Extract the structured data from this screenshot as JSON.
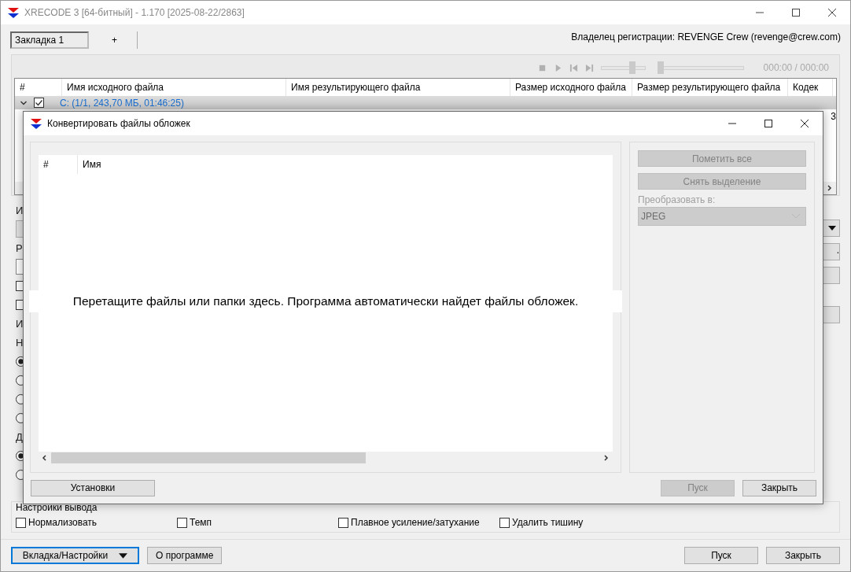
{
  "window": {
    "title": "XRECODE 3 [64-битный] - 1.170 [2025-08-22/2863]"
  },
  "tabs": [
    {
      "label": "Закладка 1",
      "selected": true
    },
    {
      "label": "+",
      "selected": false
    }
  ],
  "registration": "Владелец регистрации: REVENGE Crew (revenge@crew.com)",
  "player": {
    "volume": {
      "level": 0.75
    },
    "position": {
      "level": 0
    },
    "time": "000:00 / 000:00"
  },
  "file_table": {
    "columns": [
      "#",
      "Имя исходного файла",
      "Имя результирующего файла",
      "Размер исходного файла",
      "Размер результирующего файла",
      "Кодек"
    ],
    "groups": [
      {
        "label": "C: (1/1, 243,70 МБ, 01:46:25)",
        "expanded": true,
        "checked": true
      }
    ],
    "partial_cell": "3"
  },
  "left_fragments": [
    {
      "kind": "label",
      "text": "И"
    },
    {
      "kind": "button"
    },
    {
      "kind": "label",
      "text": "Р"
    },
    {
      "kind": "field"
    },
    {
      "kind": "checkbox",
      "checked": false
    },
    {
      "kind": "checkbox",
      "checked": false
    },
    {
      "kind": "label",
      "text": "И"
    },
    {
      "kind": "label",
      "text": "Н"
    },
    {
      "kind": "radio",
      "selected": true
    },
    {
      "kind": "radio",
      "selected": false
    },
    {
      "kind": "radio",
      "selected": false
    },
    {
      "kind": "radio",
      "selected": false
    },
    {
      "kind": "label",
      "text": "Д"
    },
    {
      "kind": "radio",
      "selected": true
    },
    {
      "kind": "radio",
      "selected": false
    }
  ],
  "right_fragments": [
    {
      "kind": "dropdown"
    },
    {
      "kind": "button",
      "text": "."
    },
    {
      "kind": "button"
    },
    {
      "kind": "button"
    }
  ],
  "dialog": {
    "title": "Конвертировать файлы обложек",
    "columns": [
      "#",
      "Имя"
    ],
    "drop_hint": "Перетащите файлы или папки здесь. Программа автоматически найдет файлы обложек.",
    "actions": [
      {
        "label": "Пометить все",
        "disabled": true
      },
      {
        "label": "Снять выделение",
        "disabled": true
      }
    ],
    "convert_label": "Преобразовать в:",
    "format": {
      "value": "JPEG",
      "disabled": true
    },
    "settings_button": "Установки",
    "buttons": [
      {
        "label": "Пуск",
        "disabled": true
      },
      {
        "label": "Закрыть",
        "disabled": false
      }
    ]
  },
  "output_settings": {
    "title": "Настройки вывода",
    "options": [
      {
        "label": "Нормализовать",
        "checked": false
      },
      {
        "label": "Темп",
        "checked": false
      },
      {
        "label": "Плавное усиление/затухание",
        "checked": false
      },
      {
        "label": "Удалить тишину",
        "checked": false
      }
    ]
  },
  "bottom_left": [
    {
      "label": "Вкладка/Настройки",
      "kind": "menu",
      "focused": true
    },
    {
      "label": "О программе",
      "kind": "plain",
      "focused": false
    }
  ],
  "bottom_right": [
    {
      "label": "Пуск"
    },
    {
      "label": "Закрыть"
    }
  ]
}
